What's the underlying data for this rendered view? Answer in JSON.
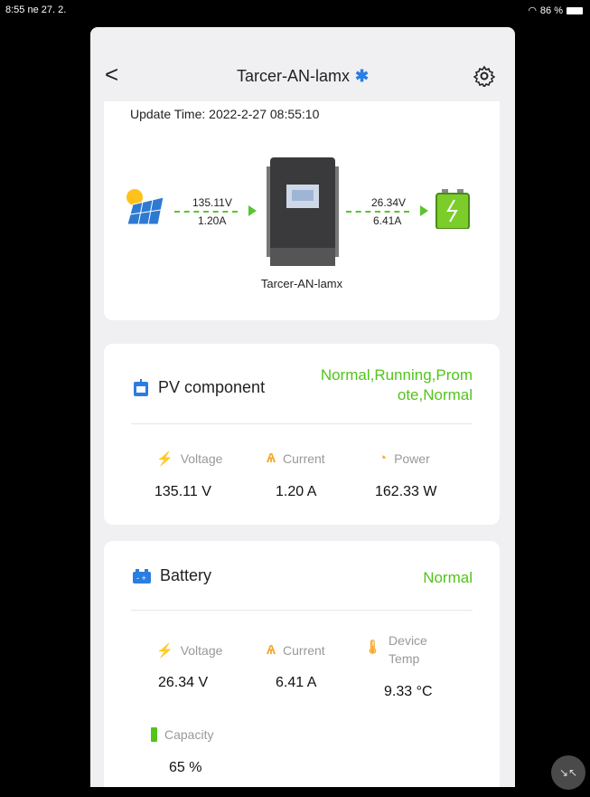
{
  "status_bar": {
    "time_date": "8:55  ne 27. 2.",
    "battery": "86 %"
  },
  "header": {
    "title": "Tarcer-AN-lamx",
    "bluetooth_icon": "bluetooth-icon",
    "settings_icon": "gear-icon"
  },
  "overview": {
    "update_time": "Update Time: 2022-2-27 08:55:10",
    "pv_voltage": "135.11V",
    "pv_current": "1.20A",
    "battery_voltage": "26.34V",
    "battery_current": "6.41A",
    "device_name": "Tarcer-AN-lamx"
  },
  "pv": {
    "title": "PV component",
    "status_line1": "Normal,Running,Prom",
    "status_line2": "ote,Normal",
    "voltage_label": "Voltage",
    "voltage_value": "135.11 V",
    "current_label": "Current",
    "current_value": "1.20 A",
    "power_label": "Power",
    "power_value": "162.33 W"
  },
  "battery": {
    "title": "Battery",
    "status": "Normal",
    "voltage_label": "Voltage",
    "voltage_value": "26.34 V",
    "current_label": "Current",
    "current_value": "6.41 A",
    "temp_label_line1": "Device",
    "temp_label_line2": "Temp",
    "temp_value": "9.33 °C",
    "capacity_label": "Capacity",
    "capacity_value": "65 %"
  },
  "colors": {
    "accent_green": "#52c41a",
    "icon_blue": "#2a7de1",
    "icon_orange": "#f5a623"
  }
}
